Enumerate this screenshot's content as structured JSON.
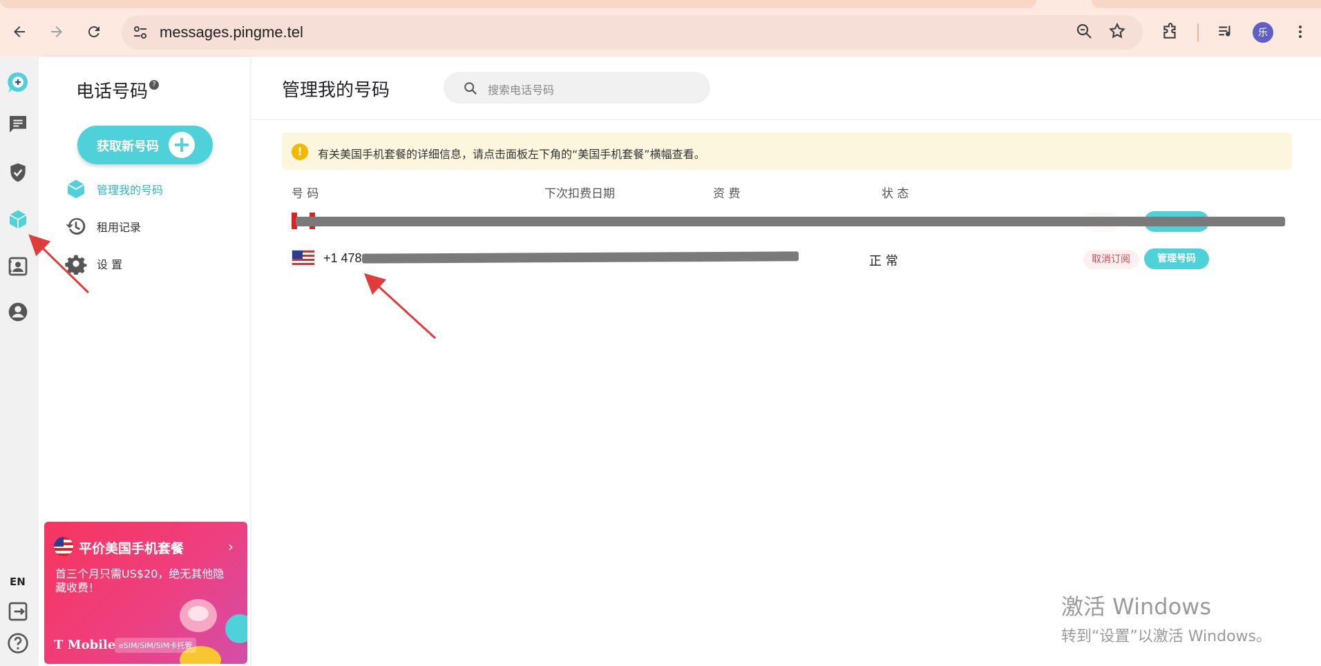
{
  "browser": {
    "url": "messages.pingme.tel",
    "avatar_letter": "乐"
  },
  "rail": {
    "language": "EN"
  },
  "sidebar": {
    "title": "电话号码",
    "help_mark": "?",
    "get_number_label": "获取新号码",
    "items": [
      {
        "label": "管理我的号码",
        "icon": "cube-icon",
        "active": true
      },
      {
        "label": "租用记录",
        "icon": "history-icon",
        "active": false
      },
      {
        "label": "设 置",
        "icon": "gear-icon",
        "active": false
      }
    ]
  },
  "promo": {
    "title": "平价美国手机套餐",
    "subtitle": "首三个月只需US$20，绝无其他隐藏收费！",
    "brand": "T Mobile",
    "tag": "eSIM/SIM/SIM卡托管"
  },
  "main": {
    "title": "管理我的号码",
    "search_placeholder": "搜索电话号码",
    "notice": "有关美国手机套餐的详细信息，请点击面板左下角的“美国手机套餐”横幅查看。",
    "columns": [
      "号 码",
      "下次扣费日期",
      "资 费",
      "状 态"
    ],
    "rows": [
      {
        "number": "",
        "status": "",
        "cancel": "",
        "manage": ""
      },
      {
        "number": "+1 478",
        "status": "正 常",
        "cancel": "取消订阅",
        "manage": "管理号码"
      }
    ]
  },
  "watermark": {
    "line1": "激活 Windows",
    "line2": "转到“设置”以激活 Windows。"
  },
  "colors": {
    "accent": "#4fd1d9",
    "cancel": "#e0444c",
    "notice_bg": "#fdf6df",
    "arrow": "#e23b3b"
  }
}
